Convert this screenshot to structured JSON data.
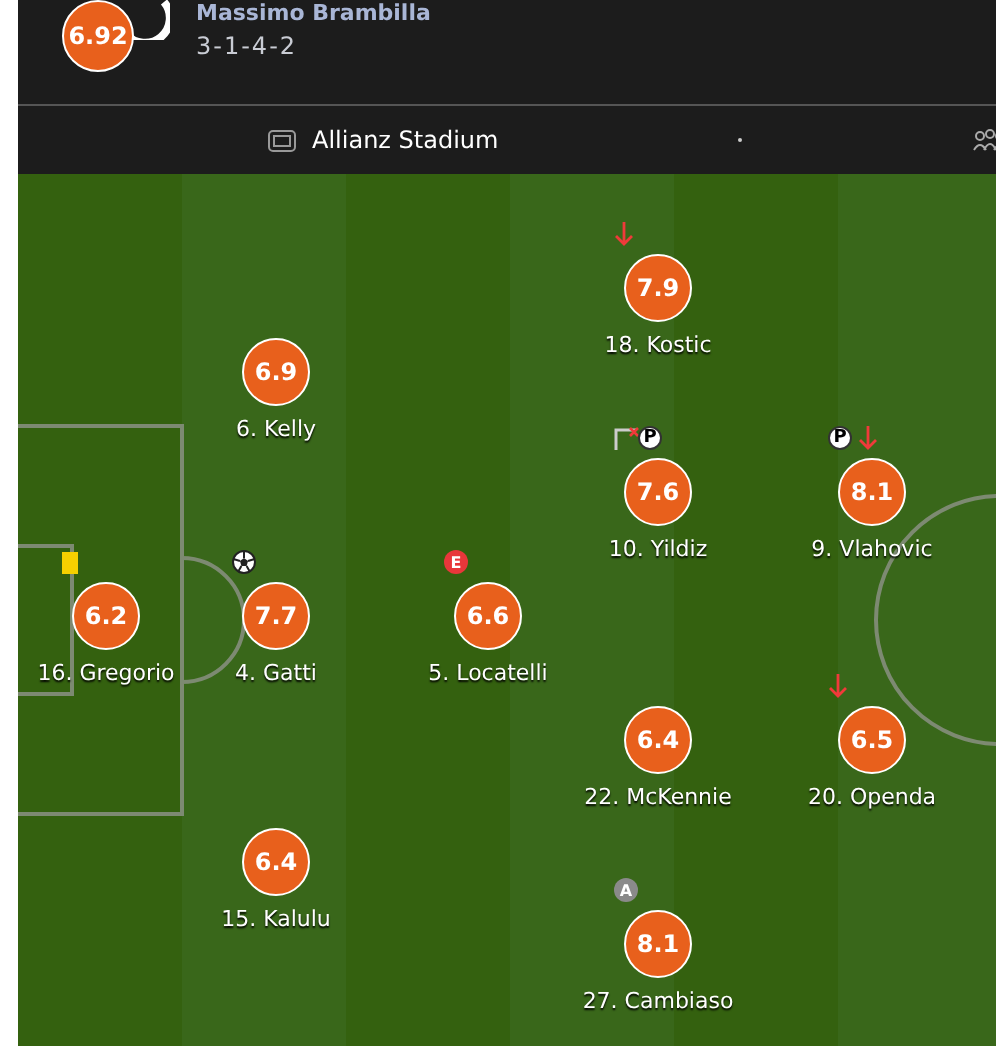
{
  "team": {
    "rating": "6.92",
    "coach": "Massimo Brambilla",
    "formation": "3-1-4-2"
  },
  "venue": {
    "stadium": "Allianz Stadium"
  },
  "lines": [
    {
      "players": [
        {
          "rating": "6.2",
          "label": "16. Gregorio",
          "events": [
            {
              "kind": "yellow-card"
            }
          ]
        }
      ]
    },
    {
      "players": [
        {
          "rating": "6.9",
          "label": "6. Kelly"
        },
        {
          "rating": "7.7",
          "label": "4. Gatti",
          "events": [
            {
              "kind": "ball"
            }
          ]
        },
        {
          "rating": "6.4",
          "label": "15. Kalulu"
        }
      ]
    },
    {
      "players": [
        {
          "rating": "6.6",
          "label": "5. Locatelli",
          "events": [
            {
              "kind": "badge",
              "text": "E",
              "color": "#e8373a"
            }
          ]
        }
      ]
    },
    {
      "players": [
        {
          "rating": "7.9",
          "label": "18. Kostic",
          "events": [
            {
              "kind": "down-arrow"
            }
          ]
        },
        {
          "rating": "7.6",
          "label": "10. Yildiz",
          "events": [
            {
              "kind": "post-cross"
            },
            {
              "kind": "ball-badge",
              "text": "P"
            }
          ]
        },
        {
          "rating": "6.4",
          "label": "22. McKennie"
        },
        {
          "rating": "8.1",
          "label": "27. Cambiaso",
          "events": [
            {
              "kind": "badge",
              "text": "A",
              "color": "#8a8a8a"
            }
          ]
        }
      ]
    },
    {
      "players": [
        {
          "rating": "8.1",
          "label": "9. Vlahovic",
          "events": [
            {
              "kind": "ball-badge",
              "text": "P"
            },
            {
              "kind": "down-arrow"
            }
          ]
        },
        {
          "rating": "6.5",
          "label": "20. Openda",
          "events": [
            {
              "kind": "down-arrow"
            }
          ]
        }
      ]
    }
  ]
}
